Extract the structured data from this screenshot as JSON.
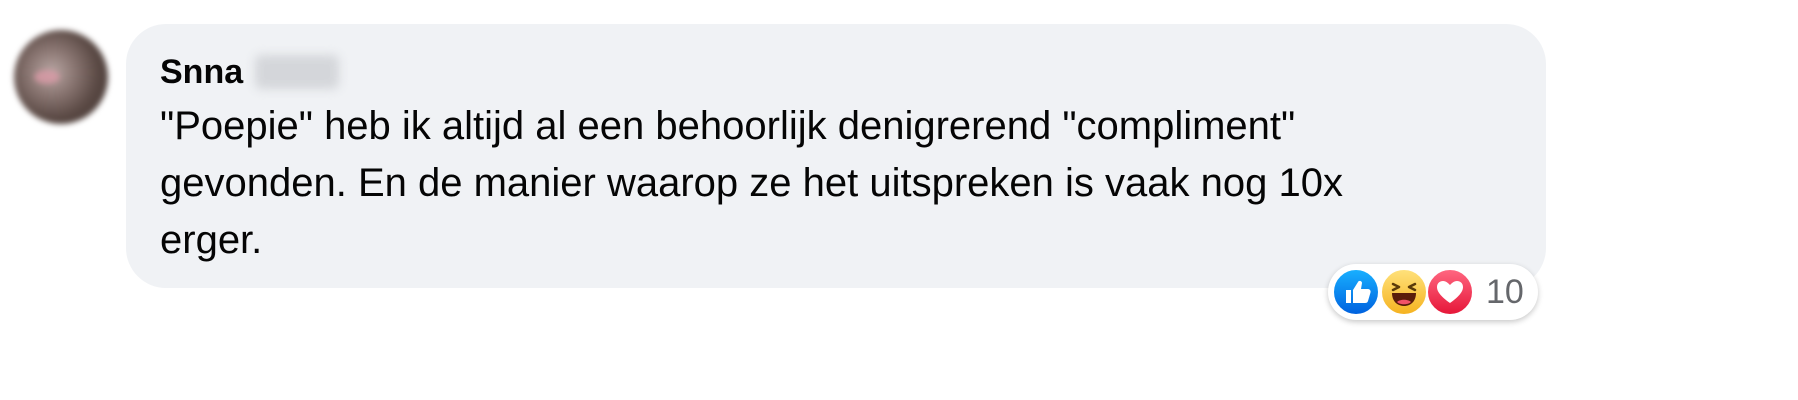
{
  "comment": {
    "author_name": "Snna",
    "text": "\"Poepie\" heb ik altijd al een behoorlijk denigrerend \"compliment\"\ngevonden. En de manier waarop ze het uitspreken is vaak nog 10x\nerger.",
    "reactions": {
      "icons": [
        "like-icon",
        "haha-icon",
        "love-icon"
      ],
      "count": "10"
    }
  },
  "colors": {
    "bubble_bg": "#f0f2f5",
    "text": "#050505",
    "muted": "#65676b",
    "like_blue": "#0866ff",
    "haha_yellow": "#f7b125",
    "love_red": "#f33e58"
  }
}
